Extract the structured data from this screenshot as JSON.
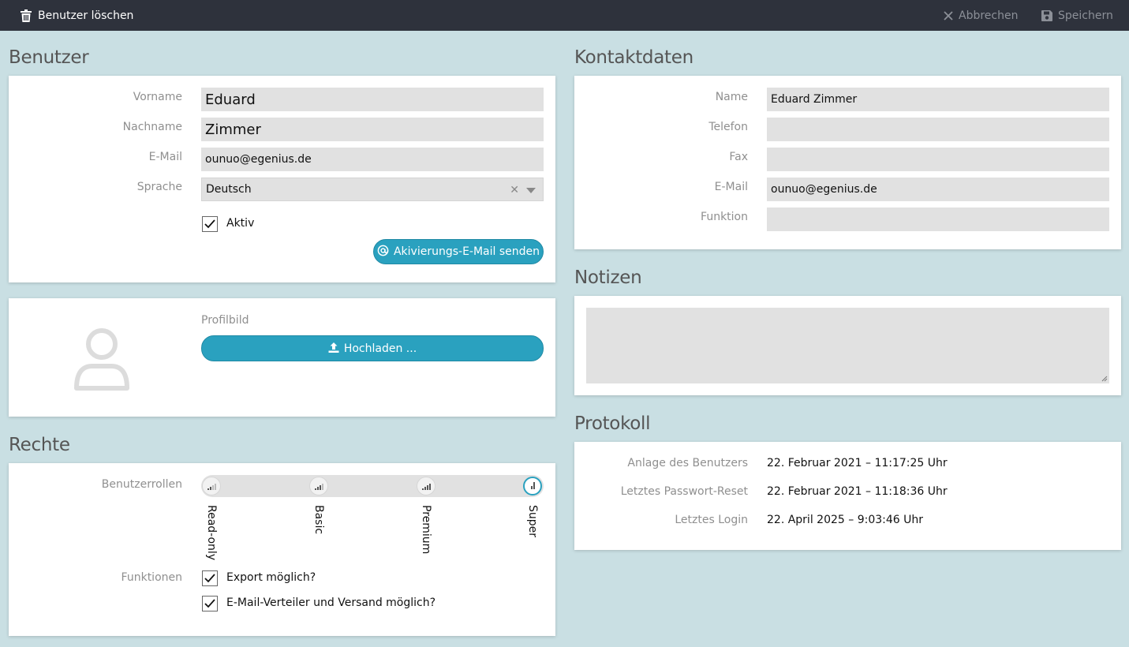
{
  "toolbar": {
    "delete_label": "Benutzer löschen",
    "cancel_label": "Abbrechen",
    "save_label": "Speichern"
  },
  "benutzer": {
    "title": "Benutzer",
    "vorname_label": "Vorname",
    "vorname_value": "Eduard",
    "nachname_label": "Nachname",
    "nachname_value": "Zimmer",
    "email_label": "E-Mail",
    "email_value": "ounuo@egenius.de",
    "sprache_label": "Sprache",
    "sprache_value": "Deutsch",
    "aktiv_label": "Aktiv",
    "aktiv_checked": true,
    "activation_button": "Akivierungs-E-Mail senden"
  },
  "profil": {
    "label": "Profilbild",
    "upload_button": "Hochladen ..."
  },
  "rechte": {
    "title": "Rechte",
    "rollen_label": "Benutzerrollen",
    "roles": [
      "Read-only",
      "Basic",
      "Premium",
      "Super"
    ],
    "selected_role": "Super",
    "funktionen_label": "Funktionen",
    "export_label": "Export möglich?",
    "export_checked": true,
    "verteiler_label": "E-Mail-Verteiler und Versand möglich?",
    "verteiler_checked": true
  },
  "kontakt": {
    "title": "Kontaktdaten",
    "name_label": "Name",
    "name_value": "Eduard Zimmer",
    "telefon_label": "Telefon",
    "telefon_value": "",
    "fax_label": "Fax",
    "fax_value": "",
    "email_label": "E-Mail",
    "email_value": "ounuo@egenius.de",
    "funktion_label": "Funktion",
    "funktion_value": ""
  },
  "notizen": {
    "title": "Notizen",
    "value": ""
  },
  "protokoll": {
    "title": "Protokoll",
    "anlage_label": "Anlage des Benutzers",
    "anlage_value": "22. Februar 2021 – 11:17:25 Uhr",
    "reset_label": "Letztes Passwort-Reset",
    "reset_value": "22. Februar 2021 – 11:18:36 Uhr",
    "login_label": "Letztes Login",
    "login_value": "22. April 2025 – 9:03:46 Uhr"
  },
  "colors": {
    "background": "#c9dfe3",
    "topbar": "#2e323c",
    "accent": "#2aa1bf",
    "field": "#e1e1e1"
  },
  "icons": {
    "delete": "trash-icon",
    "cancel": "close-icon",
    "save": "floppy-disk-icon",
    "activation": "at-icon",
    "upload": "upload-icon",
    "avatar": "user-placeholder-icon"
  }
}
